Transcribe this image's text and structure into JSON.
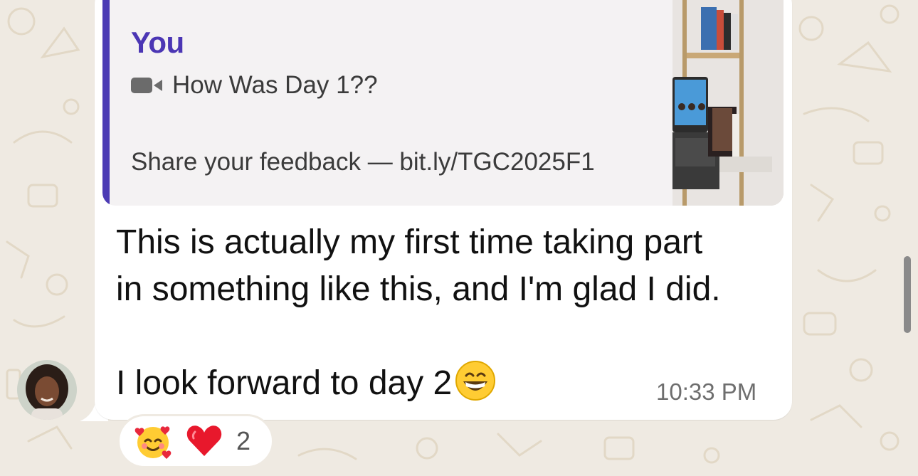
{
  "chat": {
    "quoted": {
      "author": "You",
      "media_icon": "video-camera-icon",
      "title": "How Was Day 1??",
      "body": "Share your feedback — bit.ly/TGC2025F1"
    },
    "message": {
      "line1": "This is actually my first time taking part",
      "line2": "in something like this, and I'm glad I did.",
      "line3": "I look forward to day 2",
      "emoji": "grinning-face-icon",
      "time": "10:33 PM"
    },
    "reactions": {
      "emojis": [
        "smiling-face-with-hearts-icon",
        "red-heart-icon"
      ],
      "count": "2"
    }
  },
  "colors": {
    "accent": "#4b36b4",
    "background": "#efeae2",
    "bubble": "#ffffff",
    "quote_background": "#f4f2f3"
  }
}
